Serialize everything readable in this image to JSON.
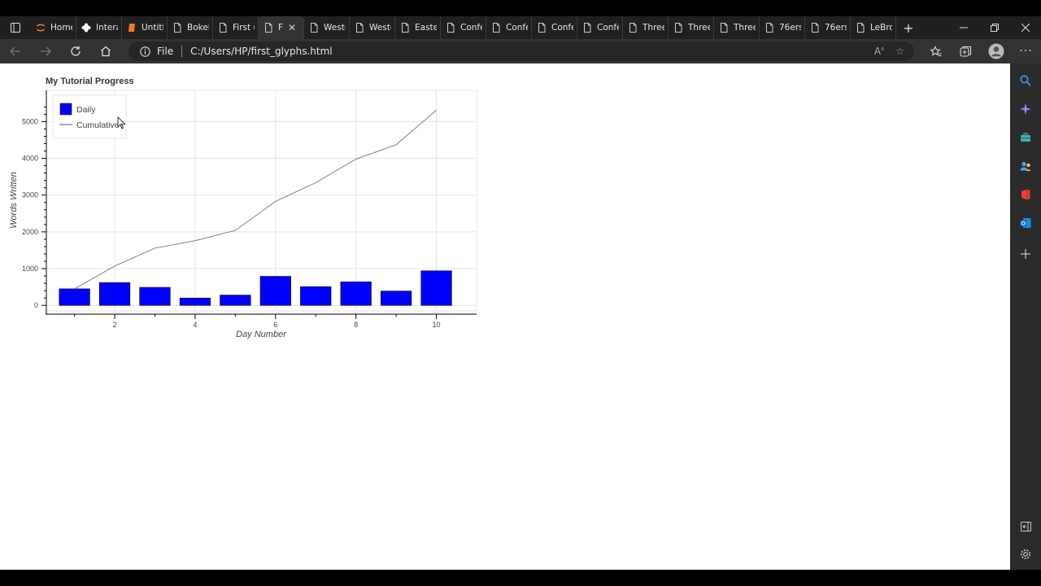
{
  "browser": {
    "tabs": [
      {
        "label": "Home",
        "icon": "jupyter-icon",
        "color": "#f37726"
      },
      {
        "label": "Intera",
        "icon": "puzzle-icon",
        "color": "#ffffff"
      },
      {
        "label": "Untitl",
        "icon": "notebook-icon",
        "color": "#f37726"
      },
      {
        "label": "Bokel",
        "icon": "page-icon",
        "color": "#cccccc"
      },
      {
        "label": "First (",
        "icon": "page-icon",
        "color": "#cccccc"
      },
      {
        "label": "F",
        "icon": "page-icon",
        "color": "#cccccc",
        "active": true
      },
      {
        "label": "Weste",
        "icon": "page-icon",
        "color": "#cccccc"
      },
      {
        "label": "Weste",
        "icon": "page-icon",
        "color": "#cccccc"
      },
      {
        "label": "Easte",
        "icon": "page-icon",
        "color": "#cccccc"
      },
      {
        "label": "Confe",
        "icon": "page-icon",
        "color": "#cccccc"
      },
      {
        "label": "Confe",
        "icon": "page-icon",
        "color": "#cccccc"
      },
      {
        "label": "Confe",
        "icon": "page-icon",
        "color": "#cccccc"
      },
      {
        "label": "Confe",
        "icon": "page-icon",
        "color": "#cccccc"
      },
      {
        "label": "Three",
        "icon": "page-icon",
        "color": "#cccccc"
      },
      {
        "label": "Three",
        "icon": "page-icon",
        "color": "#cccccc"
      },
      {
        "label": "Three",
        "icon": "page-icon",
        "color": "#cccccc"
      },
      {
        "label": "76ers",
        "icon": "page-icon",
        "color": "#cccccc"
      },
      {
        "label": "76ers",
        "icon": "page-icon",
        "color": "#cccccc"
      },
      {
        "label": "LeBro",
        "icon": "page-icon",
        "color": "#cccccc"
      }
    ],
    "address": {
      "scheme_label": "File",
      "url": "C:/Users/HP/first_glyphs.html"
    }
  },
  "chart_data": {
    "type": "bar",
    "title": "My Tutorial Progress",
    "xlabel": "Day Number",
    "ylabel": "Words Written",
    "xlim": [
      0.3,
      11.0
    ],
    "ylim": [
      -150,
      5850
    ],
    "x_ticks": [
      2,
      4,
      6,
      8,
      10
    ],
    "y_ticks": [
      0,
      1000,
      2000,
      3000,
      4000,
      5000
    ],
    "grid": true,
    "legend_position": "top-left",
    "series": [
      {
        "name": "Daily",
        "type": "bar",
        "color": "#0000ff",
        "x": [
          1,
          2,
          3,
          4,
          5,
          6,
          7,
          8,
          9,
          10
        ],
        "values": [
          450,
          620,
          490,
          200,
          280,
          790,
          510,
          640,
          390,
          940
        ]
      },
      {
        "name": "Cumulative",
        "type": "line",
        "color": "#808080",
        "x": [
          1,
          2,
          3,
          4,
          5,
          6,
          7,
          8,
          9,
          10
        ],
        "values": [
          450,
          1070,
          1560,
          1760,
          2040,
          2830,
          3340,
          3980,
          4370,
          5310
        ]
      }
    ]
  }
}
